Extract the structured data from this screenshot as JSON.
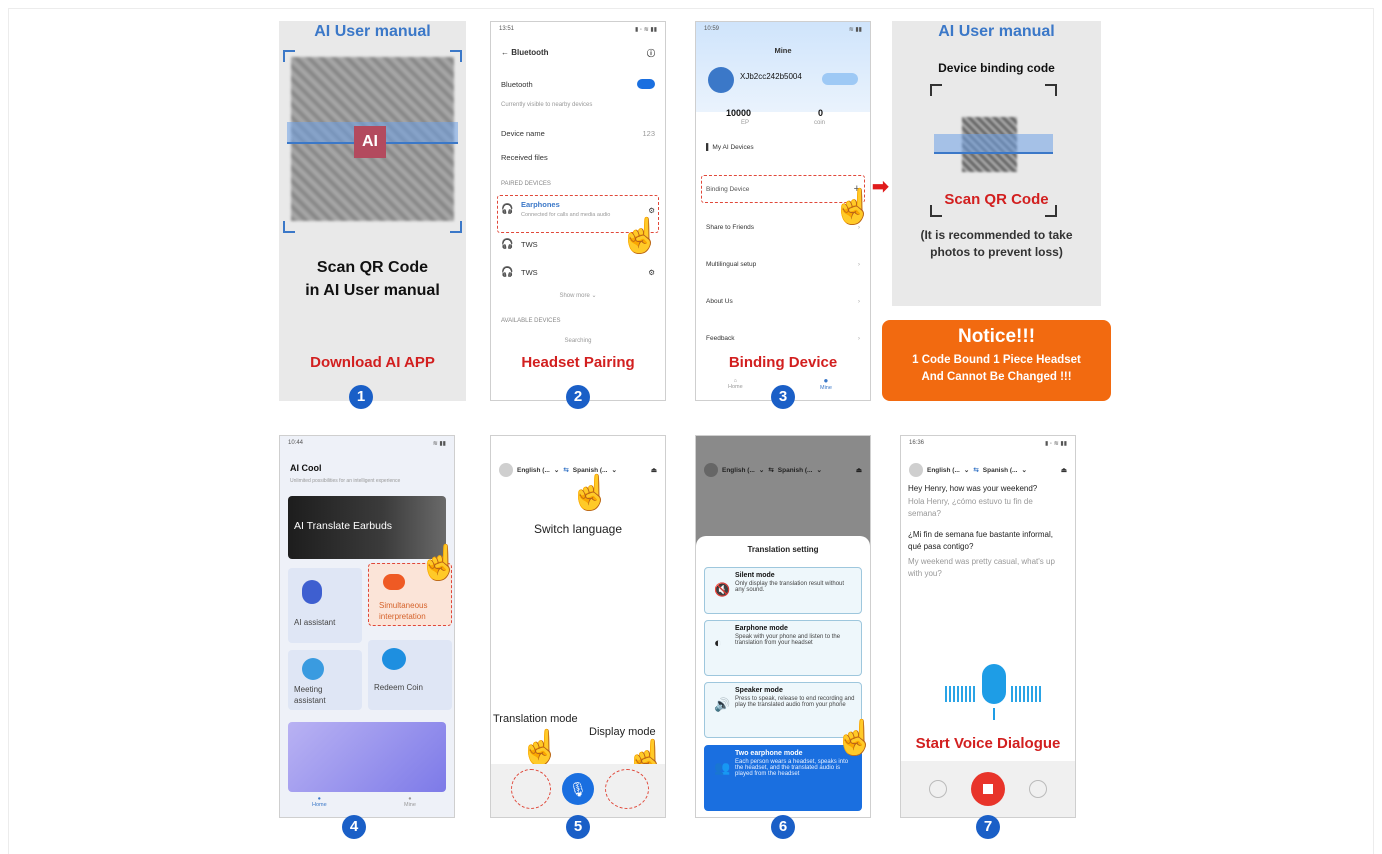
{
  "panel1": {
    "title": "AI User manual",
    "qr_logo": "AI",
    "main_text_line1": "Scan QR Code",
    "main_text_line2": "in AI User manual",
    "caption": "Download AI APP",
    "step": "1"
  },
  "panel2": {
    "status_time": "13:51",
    "header": "Bluetooth",
    "bluetooth_label": "Bluetooth",
    "visible_text": "Currently visible to nearby devices",
    "device_name_label": "Device name",
    "device_name_value": "123",
    "received_files": "Received files",
    "paired_section": "PAIRED DEVICES",
    "paired": [
      {
        "name": "Earphones",
        "sub": "Connected for calls and media audio"
      },
      {
        "name": "TWS",
        "sub": ""
      },
      {
        "name": "TWS",
        "sub": ""
      }
    ],
    "show_more": "Show more",
    "available_section": "AVAILABLE DEVICES",
    "searching": "Searching",
    "caption": "Headset Pairing",
    "step": "2"
  },
  "panel3": {
    "status_time": "10:59",
    "header": "Mine",
    "user_id": "XJb2cc242b5004",
    "stat1_value": "10000",
    "stat1_label": "EP",
    "stat2_value": "0",
    "stat2_label": "coin",
    "my_devices": "My AI Devices",
    "menu": [
      "Binding Device",
      "Share to Friends",
      "Multilingual setup",
      "About Us",
      "Feedback"
    ],
    "tab_home": "Home",
    "tab_mine": "Mine",
    "caption": "Binding Device",
    "step": "3"
  },
  "panel4": {
    "title": "AI User manual",
    "subtitle": "Device binding code",
    "scan_text": "Scan QR Code",
    "note_line1": "(It is recommended to take",
    "note_line2": "photos to prevent loss)"
  },
  "notice": {
    "title": "Notice!!!",
    "line1": "1 Code Bound 1 Piece Headset",
    "line2": "And Cannot Be Changed !!!",
    "color": "#f26a10"
  },
  "panel5": {
    "status_time": "10:44",
    "app_title": "AI Cool",
    "app_sub": "Unlimited possibilities for an intelligent experience",
    "banner": "AI Translate Earbuds",
    "tiles": [
      "AI assistant",
      "Simultaneous interpretation",
      "Meeting assistant",
      "Redeem Coin"
    ],
    "tab_home": "Home",
    "tab_mine": "Mine",
    "step": "4"
  },
  "panel6": {
    "lang_from": "English (...",
    "lang_to": "Spanish (...",
    "switch_label": "Switch language",
    "translation_mode": "Translation mode",
    "display_mode": "Display mode",
    "step": "5"
  },
  "panel7": {
    "lang_from": "English (...",
    "lang_to": "Spanish (...",
    "sheet_title": "Translation setting",
    "modes": [
      {
        "title": "Silent mode",
        "desc": "Only display the translation result without any sound."
      },
      {
        "title": "Earphone mode",
        "desc": "Speak with your phone and listen to the translation from your headset"
      },
      {
        "title": "Speaker mode",
        "desc": "Press to speak, release to end recording and play the translated audio from your phone"
      },
      {
        "title": "Two earphone mode",
        "desc": "Each person wears a headset, speaks into the headset, and the translated audio is played from the headset"
      }
    ],
    "step": "6"
  },
  "panel8": {
    "status_time": "16:36",
    "lang_from": "English (...",
    "lang_to": "Spanish (...",
    "msg1": "Hey Henry, how was your weekend?",
    "msg1_tr": "Hola Henry, ¿cómo estuvo tu fin de semana?",
    "msg2": "¿Mi fin de semana fue bastante informal, qué pasa contigo?",
    "msg2_tr": "My weekend was pretty casual, what's up with you?",
    "caption": "Start Voice Dialogue",
    "step": "7"
  }
}
